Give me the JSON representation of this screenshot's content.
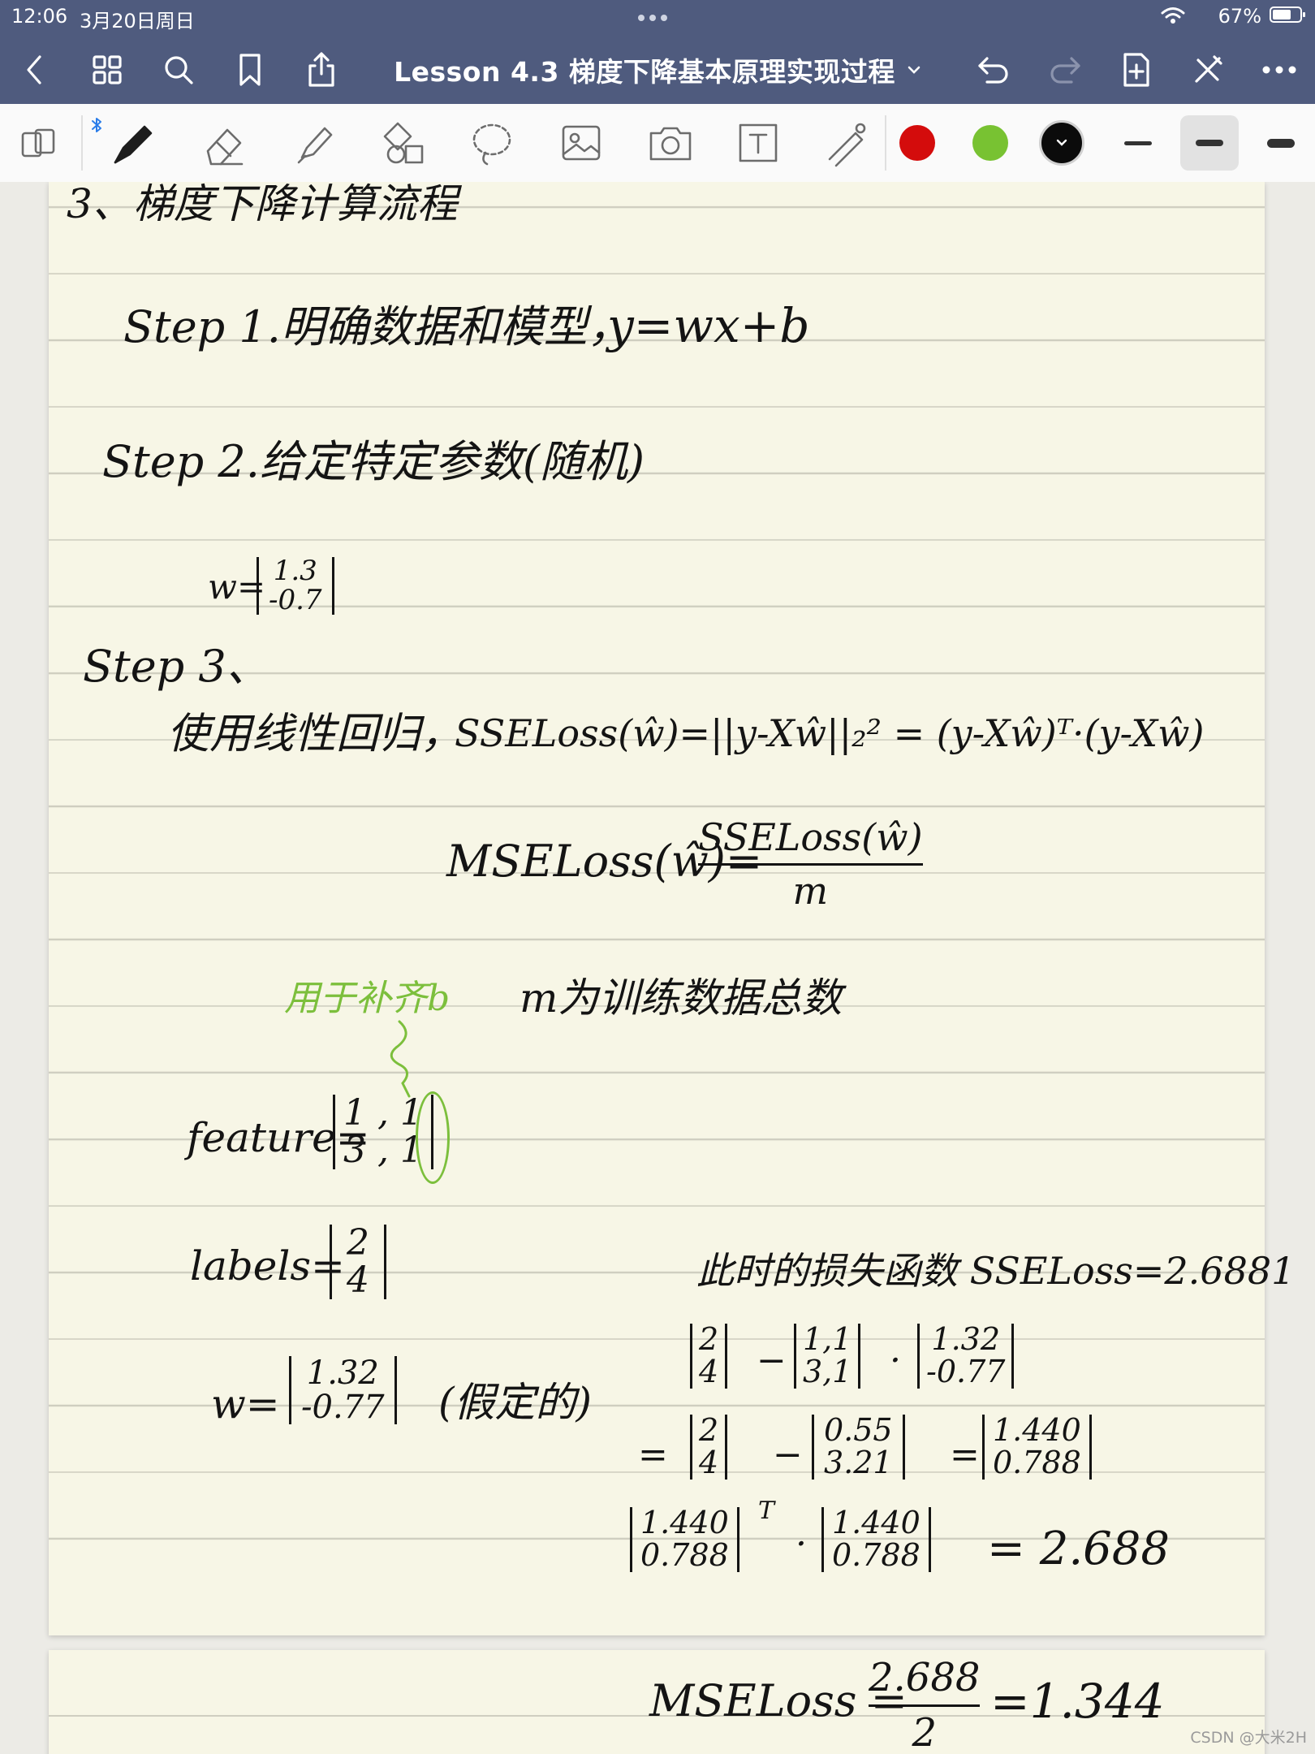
{
  "status": {
    "time": "12:06",
    "date": "3月20日周日",
    "battery": "67%"
  },
  "document": {
    "title": "Lesson 4.3 梯度下降基本原理实现过程"
  },
  "toolbar": {
    "colors": [
      "#d40c0c",
      "#78c232",
      "#0b0b0b"
    ]
  },
  "notes": {
    "section_title": "3、梯度下降计算流程",
    "step1": "Step 1.明确数据和模型，",
    "step1_formula": "y=wx+b",
    "step2": "Step 2.给定特定参数(随机)",
    "w_label": "w=",
    "w_init": [
      "1.3",
      "-0.7"
    ],
    "step3": "Step 3、",
    "step3_text": "使用线性回归，",
    "sse_formula": "SSELoss(ŵ)=||y-Xŵ||₂² = (y-Xŵ)ᵀ·(y-Xŵ)",
    "mse_lhs": "MSELoss(ŵ)=",
    "mse_num": "SSELoss(ŵ)",
    "mse_den": "m",
    "green_note": "用于补齐b",
    "m_note": "m为训练数据总数",
    "feature_label": "feature=",
    "feature": [
      [
        "1",
        ",",
        "1"
      ],
      [
        "3",
        ",",
        "1"
      ]
    ],
    "labels_label": "labels=",
    "labels": [
      "2",
      "4"
    ],
    "w2_label": "w=",
    "w2": [
      "1.32",
      "-0.77"
    ],
    "w2_note": "(假定的)",
    "loss_note": "此时的损失函数 SSELoss=2.6881",
    "calc1_a": [
      "2",
      "4"
    ],
    "calc1_b": [
      "1,1",
      "3,1"
    ],
    "calc1_c": [
      "1.32",
      "-0.77"
    ],
    "calc2_a": [
      "2",
      "4"
    ],
    "calc2_b": [
      "0.55",
      "3.21"
    ],
    "calc2_c": [
      "1.440",
      "0.788"
    ],
    "calc3_a": [
      "1.440",
      "0.788"
    ],
    "calc3_b": [
      "1.440",
      "0.788"
    ],
    "calc3_result": "= 2.688",
    "mse2_lhs": "MSELoss =",
    "mse2_num": "2.688",
    "mse2_den": "2",
    "mse2_result": "=1.344"
  },
  "watermark": "CSDN @大米2H"
}
